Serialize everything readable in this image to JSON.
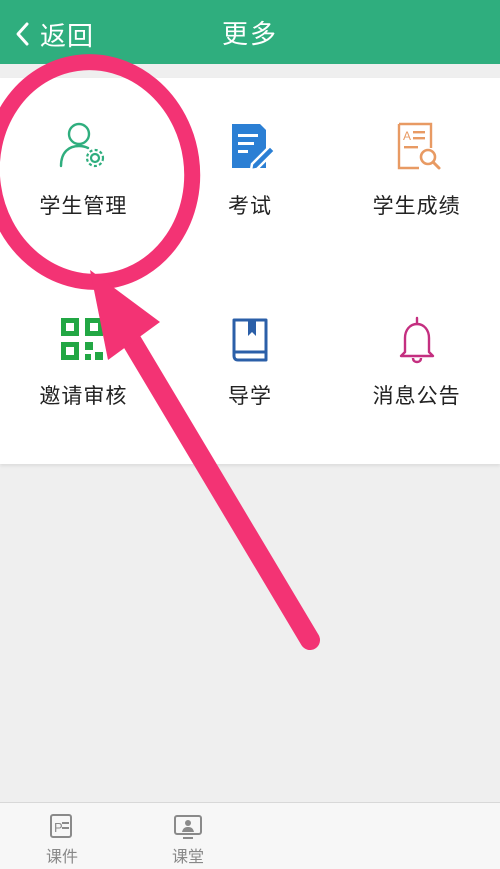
{
  "header": {
    "back_label": "返回",
    "title": "更多",
    "back_icon": "chevron-left-icon"
  },
  "tiles": [
    {
      "label": "学生管理",
      "icon": "user-gear-icon",
      "color": "#2fae7e"
    },
    {
      "label": "考试",
      "icon": "exam-edit-icon",
      "color": "#2b7fd4"
    },
    {
      "label": "学生成绩",
      "icon": "document-search-icon",
      "color": "#e89a63"
    },
    {
      "label": "邀请审核",
      "icon": "qr-code-icon",
      "color": "#22a744"
    },
    {
      "label": "导学",
      "icon": "book-icon",
      "color": "#2b5fa8"
    },
    {
      "label": "消息公告",
      "icon": "bell-icon",
      "color": "#c42f80"
    }
  ],
  "tabbar": {
    "items": [
      {
        "label": "课件",
        "icon": "courseware-icon"
      },
      {
        "label": "课堂",
        "icon": "classroom-icon"
      }
    ]
  },
  "colors": {
    "header_bg": "#2fae7e",
    "annotation": "#f33374",
    "page_bg": "#efefef"
  }
}
